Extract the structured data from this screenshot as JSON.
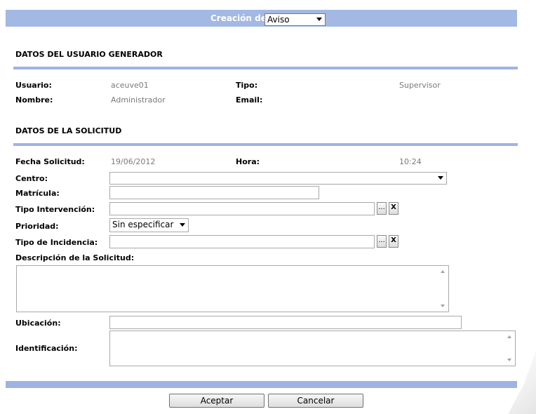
{
  "header": {
    "title": "Creación de",
    "type_select_value": "Aviso"
  },
  "usuario_section": {
    "title": "DATOS DEL USUARIO GENERADOR",
    "usuario_label": "Usuario:",
    "usuario_value": "aceuve01",
    "tipo_label": "Tipo:",
    "tipo_value": "Supervisor",
    "nombre_label": "Nombre:",
    "nombre_value": "Administrador",
    "email_label": "Email:",
    "email_value": ""
  },
  "solicitud_section": {
    "title": "DATOS DE LA SOLICITUD",
    "fecha_label": "Fecha Solicitud:",
    "fecha_value": "19/06/2012",
    "hora_label": "Hora:",
    "hora_value": "10:24",
    "centro_label": "Centro:",
    "centro_value": "",
    "matricula_label": "Matrícula:",
    "matricula_value": "",
    "tipo_intervencion_label": "Tipo Intervención:",
    "tipo_intervencion_value": "",
    "prioridad_label": "Prioridad:",
    "prioridad_value": "Sin especificar",
    "tipo_incidencia_label": "Tipo de Incidencia:",
    "tipo_incidencia_value": "",
    "descripcion_label": "Descripción de la Solicitud:",
    "descripcion_value": "",
    "ubicacion_label": "Ubicación:",
    "ubicacion_value": "",
    "identificacion_label": "Identificación:",
    "identificacion_value": "",
    "browse_label": "...",
    "clear_label": "X"
  },
  "footer": {
    "accept_label": "Aceptar",
    "cancel_label": "Cancelar"
  },
  "colors": {
    "bar": "#a3b8e3",
    "rule": "#9fb3e2"
  }
}
